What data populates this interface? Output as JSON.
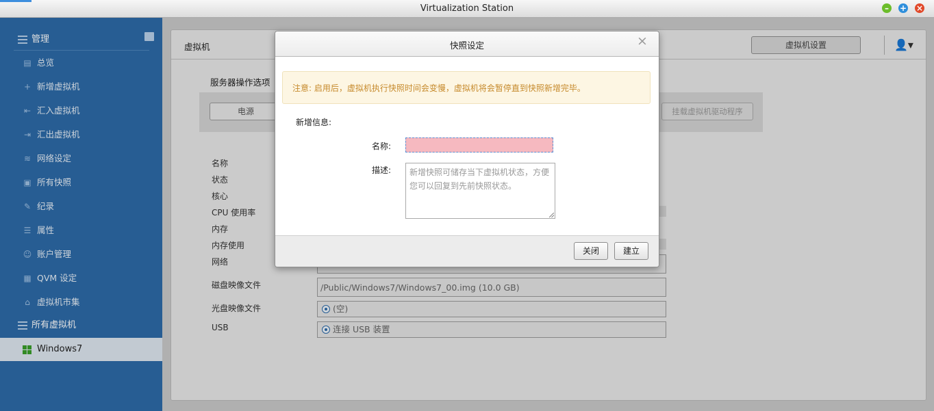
{
  "window": {
    "title": "Virtualization Station"
  },
  "sidebar": {
    "header": "管理",
    "items": [
      {
        "label": "总览",
        "icon": "overview-icon"
      },
      {
        "label": "新增虚拟机",
        "icon": "plus-icon"
      },
      {
        "label": "汇入虚拟机",
        "icon": "import-icon"
      },
      {
        "label": "汇出虚拟机",
        "icon": "export-icon"
      },
      {
        "label": "网络设定",
        "icon": "network-icon"
      },
      {
        "label": "所有快照",
        "icon": "snapshot-icon"
      },
      {
        "label": "纪录",
        "icon": "log-icon"
      },
      {
        "label": "属性",
        "icon": "properties-icon"
      },
      {
        "label": "账户管理",
        "icon": "account-icon"
      },
      {
        "label": "QVM 设定",
        "icon": "qvm-icon"
      },
      {
        "label": "虚拟机市集",
        "icon": "market-icon"
      }
    ],
    "group": "所有虚拟机",
    "vm": "Windows7"
  },
  "main": {
    "breadcrumb": "虚拟机",
    "vm_settings_button": "虚拟机设置",
    "section_title": "服务器操作选项",
    "power_button": "电源",
    "driver_button": "挂载虚拟机驱动程序",
    "info_labels": [
      "名称",
      "状态",
      "核心",
      "CPU 使用率",
      "内存",
      "内存使用",
      "网络",
      "磁盘映像文件",
      "光盘映像文件",
      "USB"
    ],
    "disk_image": "/Public/Windows7/Windows7_00.img (10.0 GB)",
    "cd_image": "(空)",
    "usb": "连接 USB 装置"
  },
  "dialog": {
    "title": "快照设定",
    "notice": "注意: 启用后，虚拟机执行快照时间会变慢，虚拟机将会暂停直到快照新增完毕。",
    "section": "新增信息:",
    "name_label": "名称:",
    "name_value": "",
    "desc_label": "描述:",
    "desc_placeholder": "新增快照可储存当下虚拟机状态，方便您可以回复到先前快照状态。",
    "close_button": "关闭",
    "create_button": "建立"
  }
}
